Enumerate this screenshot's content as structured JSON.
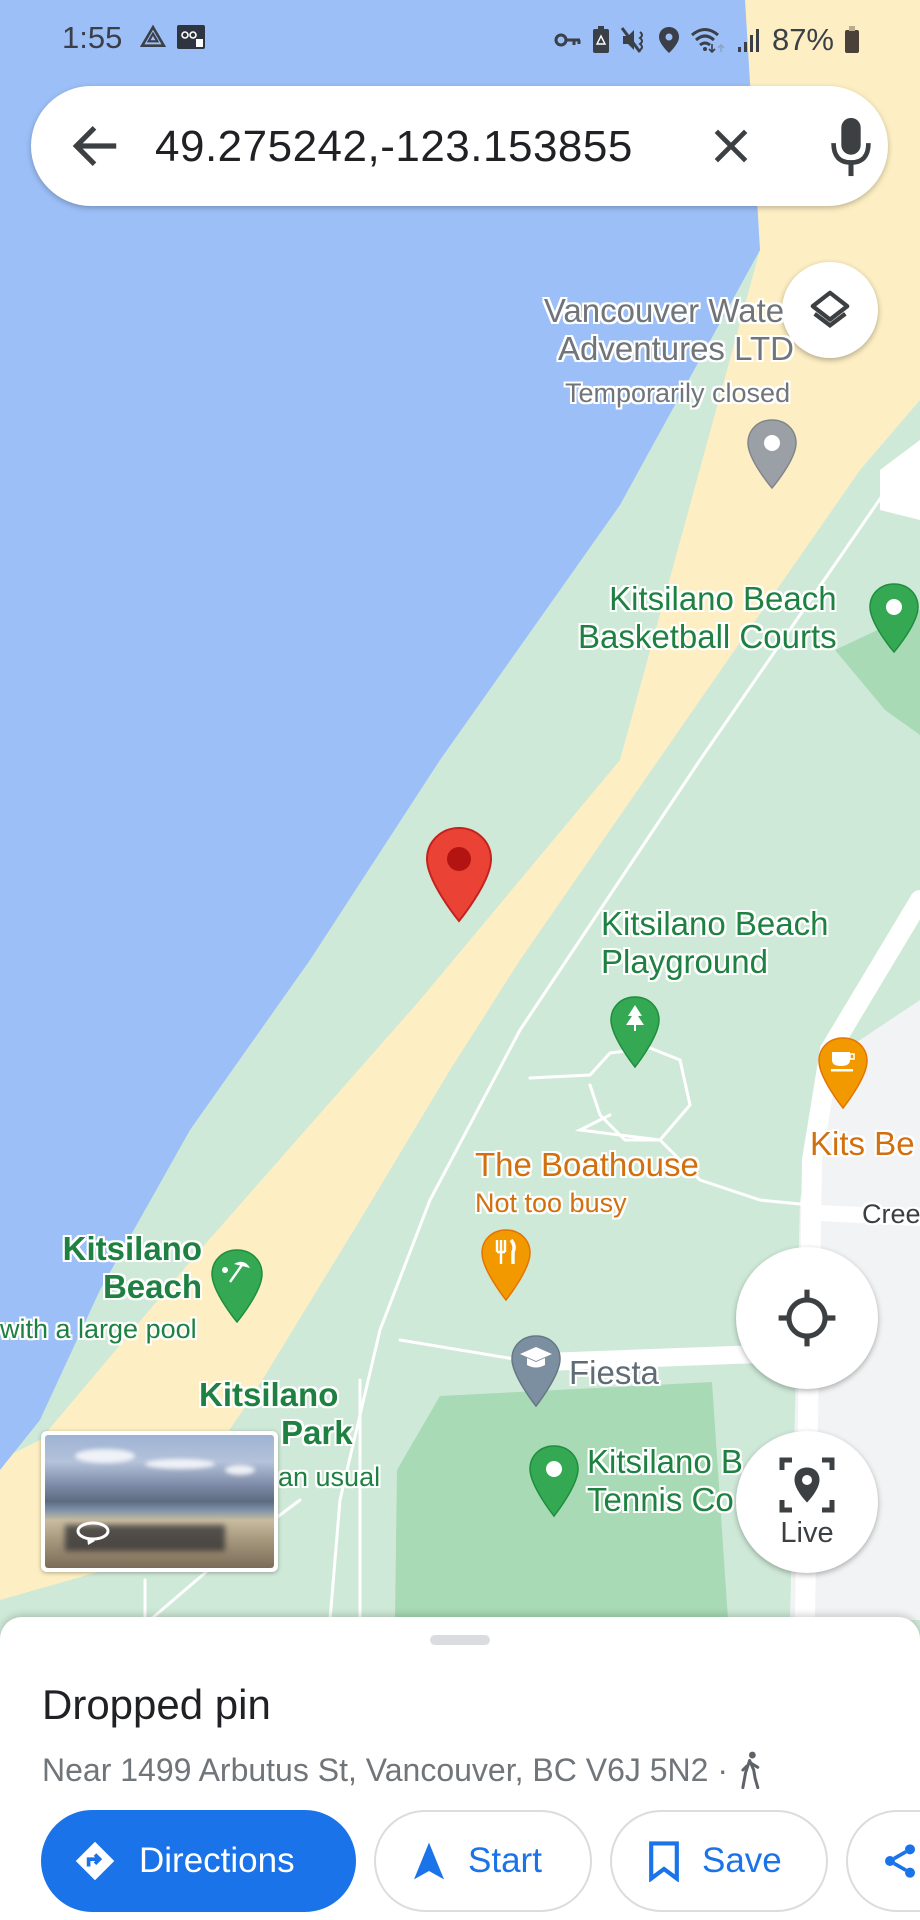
{
  "status_bar": {
    "time": "1:55",
    "left_icons": [
      "drive-icon",
      "voicemail-icon"
    ],
    "right_icons": [
      "vpn-key-icon",
      "battery-saver-icon",
      "mute-icon",
      "location-icon",
      "wifi-icon",
      "signal-icon"
    ],
    "battery_percent": "87%"
  },
  "search": {
    "query": "49.275242,-123.153855",
    "back_icon": "arrow-back-icon",
    "clear_icon": "close-icon",
    "voice_icon": "mic-icon"
  },
  "map": {
    "colors": {
      "water": "#9cbff7",
      "sand": "#fdefc3",
      "park": "#cfe9d8",
      "park_dark": "#a8dab5",
      "road": "#ffffff",
      "urban": "#f1f3f4",
      "pin_red": "#ea4335",
      "pin_green": "#34a853",
      "pin_orange": "#f29900",
      "pin_gray": "#9aa0a6"
    },
    "places": [
      {
        "name": "Vancouver Water Adventures LTD",
        "line1": "Vancouver Wate",
        "line2": "Adventures LTD",
        "status": "Temporarily closed",
        "category": "closed"
      },
      {
        "name": "Kitsilano Beach Basketball Courts",
        "line1": "Kitsilano Beach",
        "line2": "Basketball Courts",
        "category": "park"
      },
      {
        "name": "Kitsilano Beach Playground",
        "line1": "Kitsilano Beach",
        "line2": "Playground",
        "category": "park-tree"
      },
      {
        "name": "Kits Beach Coffee",
        "line1": "Kits Be",
        "category": "cafe"
      },
      {
        "name": "The Boathouse",
        "line1": "The Boathouse",
        "status": "Not too busy",
        "category": "restaurant"
      },
      {
        "name": "Kitsilano Beach",
        "line1": "Kitsilano",
        "line2": "Beach",
        "status": "with a large pool",
        "category": "beach"
      },
      {
        "name": "Kitsilano Beach Park",
        "line1": "Kitsilano",
        "line2": "Beach Park",
        "line2_visible": "Park",
        "status": "an usual",
        "category": "park"
      },
      {
        "name": "Fiesta",
        "line1": "Fiesta",
        "category": "school"
      },
      {
        "name": "Kitsilano Beach Tennis Courts",
        "line1": "Kitsilano B",
        "line2": "Tennis Co",
        "category": "park"
      }
    ],
    "street_label": "Cree",
    "dropped_pin": {
      "lat": 49.275242,
      "lng": -123.153855
    }
  },
  "controls": {
    "layers_icon": "layers-icon",
    "locate_icon": "my-location-icon",
    "live_label": "Live",
    "live_icon": "live-view-icon",
    "street_view_icon": "rotate-360-icon"
  },
  "sheet": {
    "title": "Dropped pin",
    "subtitle": "Near 1499 Arbutus St, Vancouver, BC V6J 5N2 ·",
    "travel_mode_icon": "walking-icon",
    "actions": [
      {
        "label": "Directions",
        "icon": "directions-icon",
        "primary": true
      },
      {
        "label": "Start",
        "icon": "navigation-arrow-icon"
      },
      {
        "label": "Save",
        "icon": "bookmark-icon"
      },
      {
        "label": "",
        "icon": "share-icon"
      }
    ],
    "accent_color": "#1a73e8"
  }
}
